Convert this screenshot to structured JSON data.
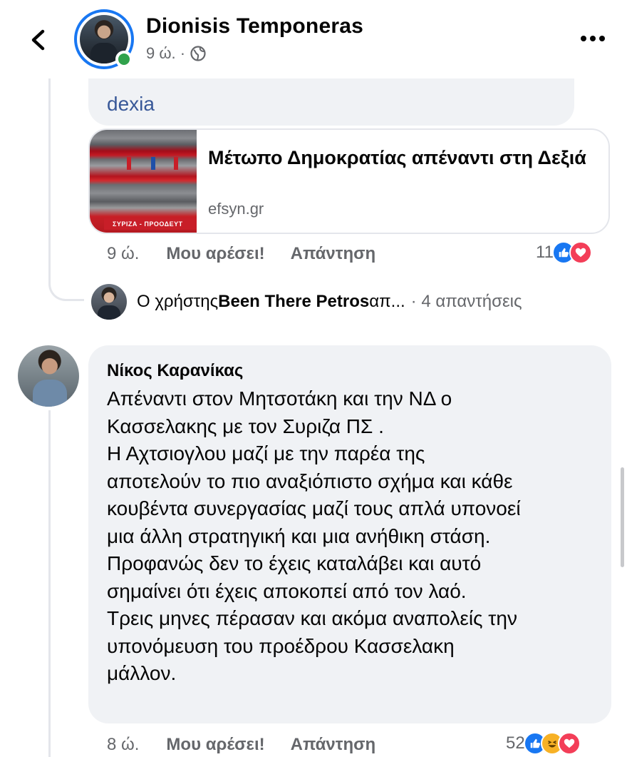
{
  "header": {
    "title": "Dionisis Temponeras",
    "time": "9 ώ. ·",
    "back_icon": "chevron-left-icon",
    "privacy_icon": "globe-icon",
    "more_icon": "more-horizontal-icon"
  },
  "comment1": {
    "text_tail": "dexia",
    "link": {
      "title": "Μέτωπο Δημοκρατίας απέναντι στη Δεξιά",
      "domain": "efsyn.gr",
      "thumb_sign": "ΣΥΡΙΖΑ - ΠΡΟΟΔΕΥΤ"
    },
    "time": "9 ώ.",
    "like_label": "Μου αρέσει!",
    "reply_label": "Απάντηση",
    "reaction_count": "11",
    "replies": {
      "prefix": "Ο χρήστης ",
      "user": "Been There Petros",
      "suffix": " απ...",
      "count": "· 4 απαντήσεις"
    }
  },
  "comment2": {
    "author": "Νίκος Καρανίκας",
    "lines": [
      "Απέναντι στον Μητσοτάκη και την ΝΔ ο",
      "Κασσελακης με τον Συριζα ΠΣ .",
      "Η Αχτσιογλου μαζί με την παρέα της",
      "αποτελούν το πιο αναξιόπιστο σχήμα και κάθε",
      "κουβέντα συνεργασίας μαζί τους απλά υπονοεί",
      "μια άλλη στρατηγική και μια ανήθικη στάση.",
      "Προφανώς δεν το έχεις καταλάβει και αυτό",
      "σημαίνει ότι έχεις αποκοπεί από τον λαό.",
      "Τρεις μηνες πέρασαν και ακόμα αναπολείς την",
      "υπονόμευση του προέδρου Κασσελακη",
      "μάλλον."
    ],
    "time": "8 ώ.",
    "like_label": "Μου αρέσει!",
    "reply_label": "Απάντηση",
    "reaction_count": "52"
  },
  "colors": {
    "accent": "#1877f2",
    "bubble": "#f0f2f5",
    "muted": "#65676b",
    "love": "#f33e58",
    "online": "#31a24c"
  }
}
